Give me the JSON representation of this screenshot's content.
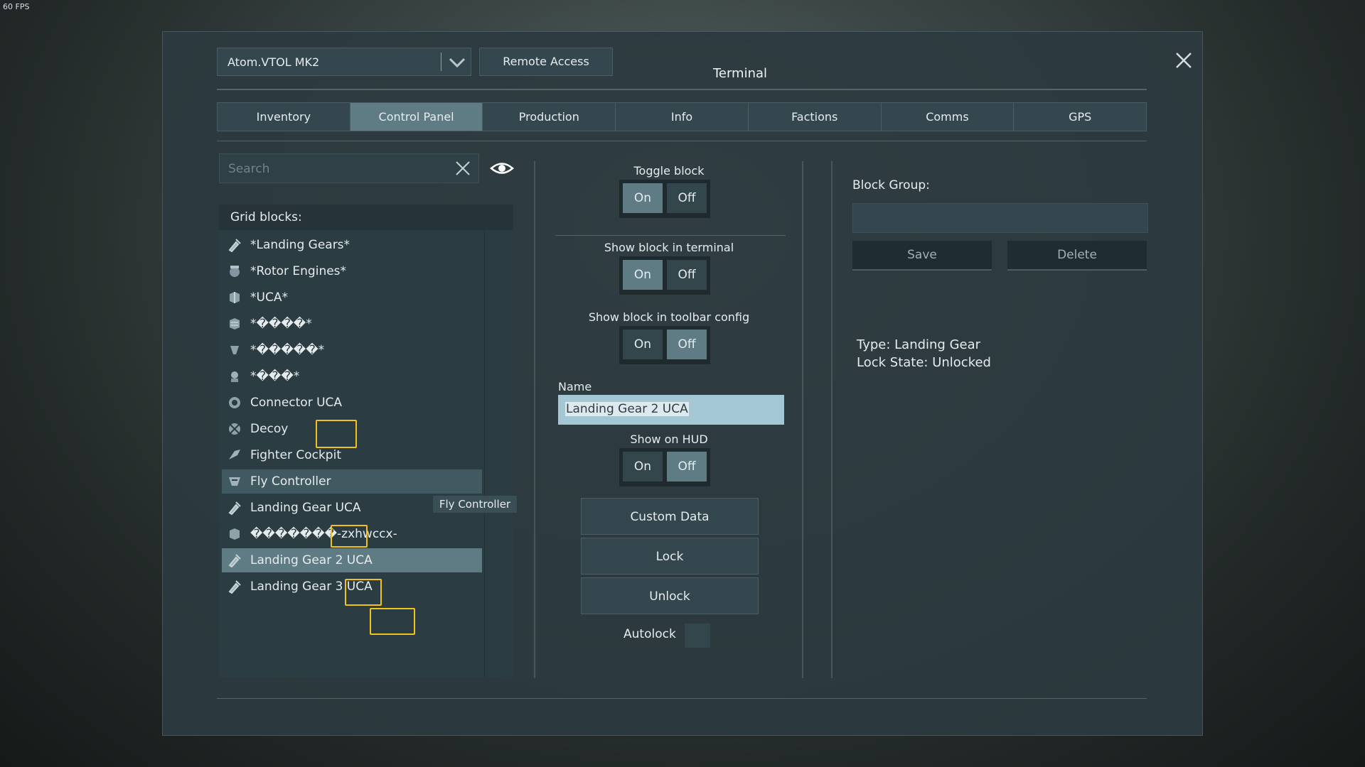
{
  "fps": "60 FPS",
  "header": {
    "grid_name": "Atom.VTOL  MK2",
    "remote_access_label": "Remote Access",
    "title": "Terminal"
  },
  "tabs": [
    {
      "label": "Inventory",
      "active": false
    },
    {
      "label": "Control Panel",
      "active": true
    },
    {
      "label": "Production",
      "active": false
    },
    {
      "label": "Info",
      "active": false
    },
    {
      "label": "Factions",
      "active": false
    },
    {
      "label": "Comms",
      "active": false
    },
    {
      "label": "GPS",
      "active": false
    }
  ],
  "left": {
    "search_placeholder": "Search",
    "grid_blocks_label": "Grid blocks:",
    "items": [
      {
        "label": "*Landing Gears*",
        "icon": "landing-gear-icon"
      },
      {
        "label": "*Rotor Engines*",
        "icon": "rotor-icon"
      },
      {
        "label": "*UCA*",
        "icon": "cube-icon"
      },
      {
        "label": "*����*",
        "icon": "cube-icon"
      },
      {
        "label": "*�����*",
        "icon": "thruster-icon"
      },
      {
        "label": "*���*",
        "icon": "sensor-icon"
      },
      {
        "label": "Connector UCA",
        "icon": "connector-icon"
      },
      {
        "label": "Decoy",
        "icon": "decoy-icon"
      },
      {
        "label": "Fighter Cockpit",
        "icon": "cockpit-icon"
      },
      {
        "label": "Fly Controller",
        "icon": "controller-icon",
        "state": "hover"
      },
      {
        "label": "Landing Gear UCA",
        "icon": "landing-gear-icon"
      },
      {
        "label": "�������-zxhwccx-",
        "icon": "cube-icon"
      },
      {
        "label": "Landing Gear 2 UCA",
        "icon": "landing-gear-icon",
        "state": "selected"
      },
      {
        "label": "Landing Gear 3 UCA",
        "icon": "landing-gear-icon"
      }
    ],
    "tooltip": "Fly Controller",
    "highlight_color": "#f2c21a"
  },
  "center": {
    "toggle_block": {
      "label": "Toggle block",
      "on": "On",
      "off": "Off",
      "value": "On"
    },
    "show_in_terminal": {
      "label": "Show block in terminal",
      "on": "On",
      "off": "Off",
      "value": "On"
    },
    "show_in_toolbar": {
      "label": "Show block in toolbar config",
      "on": "On",
      "off": "Off",
      "value": "Off"
    },
    "name_label": "Name",
    "name_value": "Landing Gear 2 UCA",
    "show_on_hud": {
      "label": "Show on HUD",
      "on": "On",
      "off": "Off",
      "value": "Off"
    },
    "custom_data_label": "Custom Data",
    "lock_label": "Lock",
    "unlock_label": "Unlock",
    "autolock_label": "Autolock"
  },
  "right": {
    "block_group_label": "Block Group:",
    "save_label": "Save",
    "delete_label": "Delete",
    "type_line": "Type: Landing Gear",
    "lock_state_line": "Lock State: Unlocked"
  },
  "colors": {
    "panel": "#2c3a3f",
    "button": "#34474e",
    "active": "#5f7b84",
    "name_input": "#a4c7d4"
  }
}
